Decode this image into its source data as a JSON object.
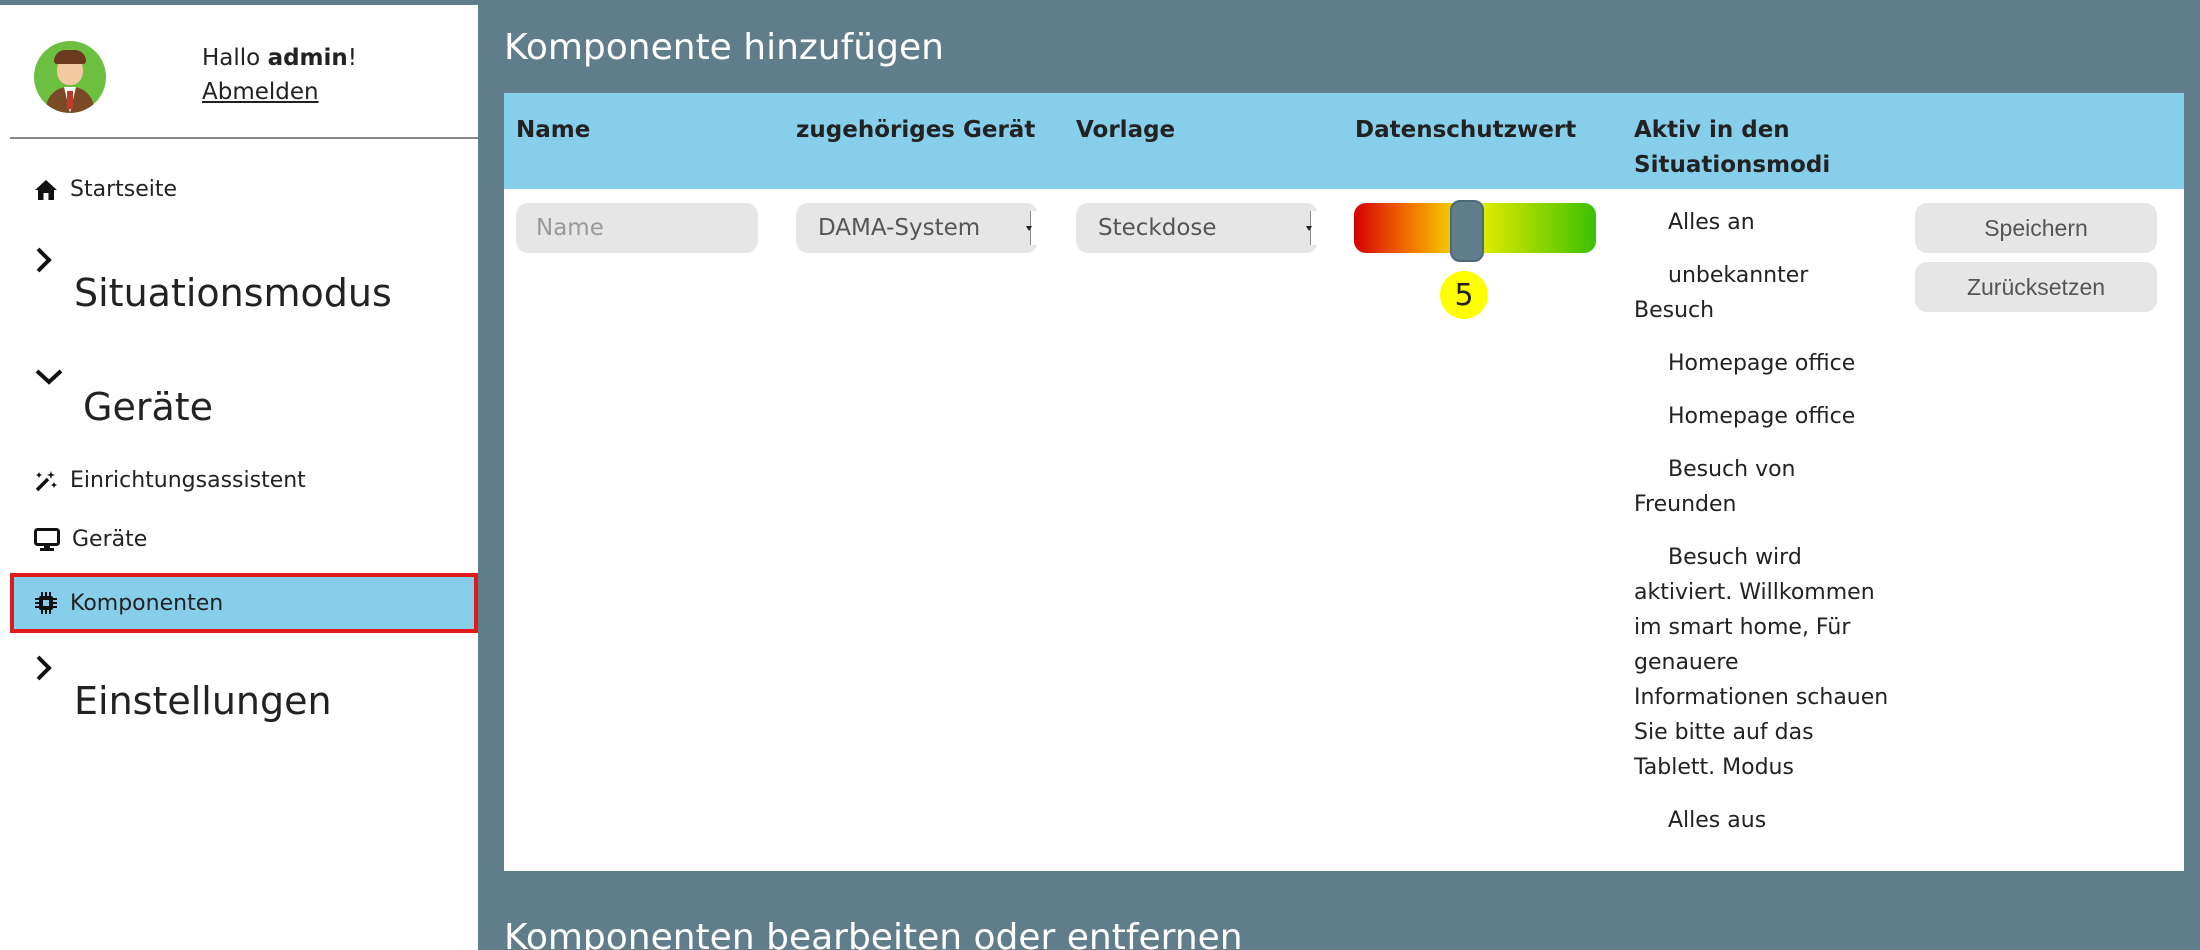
{
  "user": {
    "greeting_prefix": "Hallo",
    "name": "admin",
    "greeting_suffix": "!",
    "logout_label": "Abmelden"
  },
  "sidebar": {
    "home_label": "Startseite",
    "groups": [
      {
        "label": "Situationsmodus",
        "expanded": false
      },
      {
        "label": "Geräte",
        "expanded": true
      },
      {
        "label": "Einstellungen",
        "expanded": false
      }
    ],
    "items": [
      {
        "label": "Einrichtungsassistent",
        "icon": "magic-wand-icon"
      },
      {
        "label": "Geräte",
        "icon": "monitor-icon"
      },
      {
        "label": "Komponenten",
        "icon": "chip-icon",
        "active": true
      }
    ]
  },
  "main": {
    "add_title": "Komponente hinzufügen",
    "edit_title": "Komponenten bearbeiten oder entfernen",
    "columns": [
      "Name",
      "zugehöriges Gerät",
      "Vorlage",
      "Datenschutzwert",
      "Aktiv in den Situationsmodi"
    ],
    "name_placeholder": "Name",
    "device_selected": "DAMA-System",
    "template_selected": "Steckdose",
    "privacy_value": "5",
    "modes": [
      "Alles an",
      "unbekannter Besuch",
      "Homepage office",
      "Homepage office",
      "Besuch von Freunden",
      "Besuch wird aktiviert. Willkommen im smart home, Für genauere Informationen schauen Sie bitte auf das Tablett. Modus",
      "Alles aus"
    ],
    "save_label": "Speichern",
    "reset_label": "Zurücksetzen"
  },
  "colors": {
    "main_bg": "#607d8b",
    "header_bg": "#87ceeb",
    "active_border": "#e01b1b",
    "pill_bg": "#e6e6e6"
  }
}
